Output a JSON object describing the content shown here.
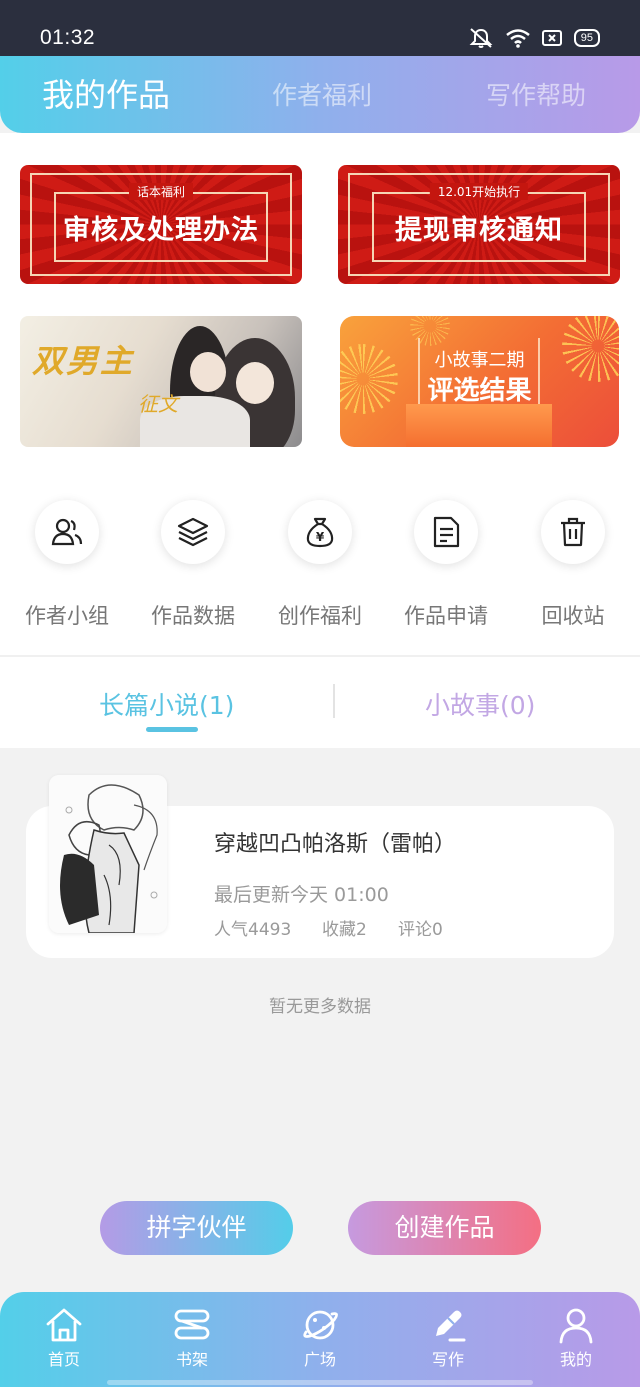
{
  "status_bar": {
    "time": "01:32",
    "battery": "95"
  },
  "top_tabs": [
    {
      "label": "我的作品",
      "active": true
    },
    {
      "label": "作者福利",
      "active": false
    },
    {
      "label": "写作帮助",
      "active": false
    }
  ],
  "banners": {
    "review": {
      "tag": "话本福利",
      "title": "审核及处理办法"
    },
    "withdraw": {
      "tag": "12.01开始执行",
      "title": "提现审核通知"
    },
    "art": {
      "text": "双男主",
      "sub": "征文"
    },
    "story": {
      "line1": "小故事二期",
      "line2": "评选结果"
    }
  },
  "quick_actions": [
    {
      "label": "作者小组",
      "icon": "author-group-icon"
    },
    {
      "label": "作品数据",
      "icon": "layers-icon"
    },
    {
      "label": "创作福利",
      "icon": "money-bag-icon"
    },
    {
      "label": "作品申请",
      "icon": "document-icon"
    },
    {
      "label": "回收站",
      "icon": "trash-icon"
    }
  ],
  "work_tabs": [
    {
      "label": "长篇小说(1)",
      "active": true
    },
    {
      "label": "小故事(0)",
      "active": false
    }
  ],
  "book": {
    "title": "穿越凹凸帕洛斯（雷帕）",
    "updated": "最后更新今天 01:00",
    "popularity": "人气4493",
    "favorites": "收藏2",
    "comments": "评论0"
  },
  "no_more": "暂无更多数据",
  "buttons": {
    "partner": "拼字伙伴",
    "create": "创建作品"
  },
  "bottom_nav": [
    {
      "label": "首页",
      "icon": "home-icon"
    },
    {
      "label": "书架",
      "icon": "bookshelf-icon"
    },
    {
      "label": "广场",
      "icon": "planet-icon"
    },
    {
      "label": "写作",
      "icon": "pen-icon",
      "active": true
    },
    {
      "label": "我的",
      "icon": "profile-icon"
    }
  ],
  "colors": {
    "accent_blue": "#5ac3e2",
    "accent_purple": "#c2a7e4",
    "banner_red": "#cf1b15"
  }
}
